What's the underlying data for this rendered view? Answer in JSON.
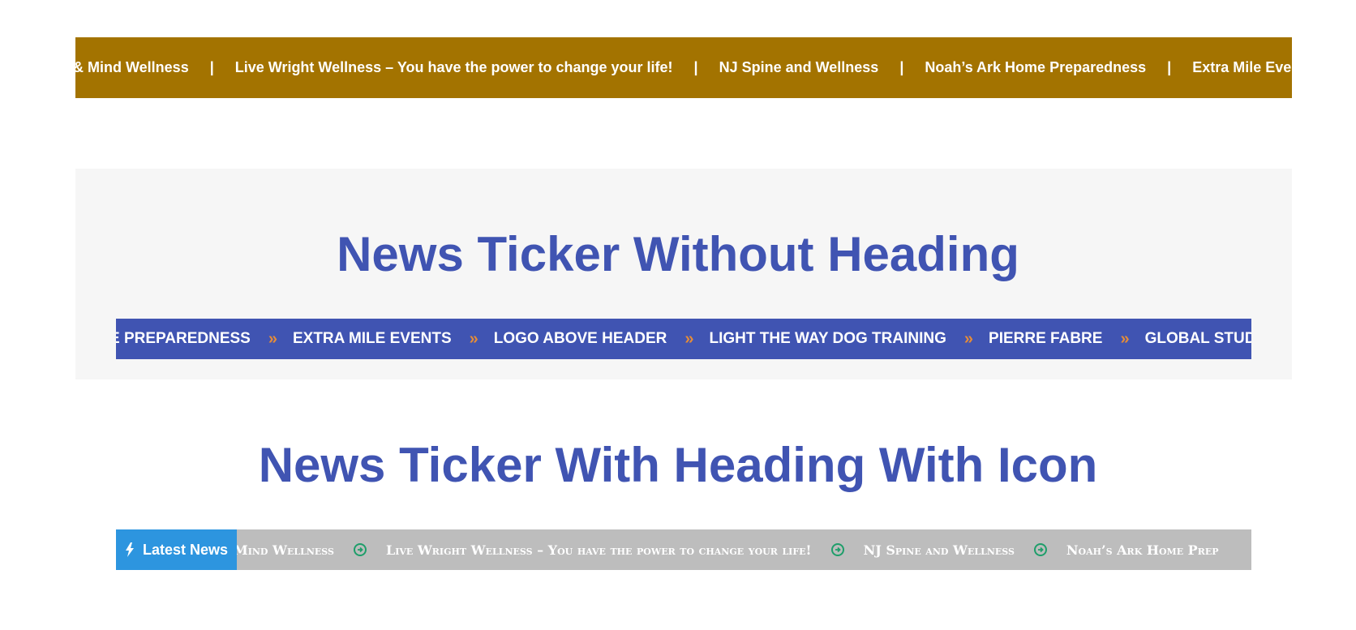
{
  "ticker1": {
    "items": [
      "y & Mind Wellness",
      "Live Wright Wellness – You have the power to change your life!",
      "NJ Spine and Wellness",
      "Noah’s Ark Home Preparedness",
      "Extra Mile Eve"
    ],
    "separator": "|",
    "colors": {
      "background": "#a37300",
      "text": "#ffffff"
    }
  },
  "section2": {
    "heading": "News Ticker Without Heading",
    "ticker": {
      "items": [
        "E PREPAREDNESS",
        "EXTRA MILE EVENTS",
        "LOGO ABOVE HEADER",
        "LIGHT THE WAY DOG TRAINING",
        "PIERRE FABRE",
        "GLOBAL STUDENT EM"
      ],
      "separator": "»",
      "separator_icon": "double-chevron-right-icon",
      "colors": {
        "background": "#4054b2",
        "text": "#ffffff",
        "separator": "#e58c38"
      }
    }
  },
  "section3": {
    "heading": "News Ticker With Heading With Icon",
    "ticker": {
      "label": "Latest News",
      "label_icon": "bolt-icon",
      "items": [
        "Mind Wellness",
        "Live Wright Wellness – You have the power to change your life!",
        "NJ Spine and Wellness",
        "Noah’s Ark Home Prep"
      ],
      "separator_icon": "arrow-circle-right-icon",
      "colors": {
        "label_background": "#2d95df",
        "background": "#bdbdbd",
        "text": "#ffffff",
        "separator": "#1e9e6a"
      }
    }
  }
}
